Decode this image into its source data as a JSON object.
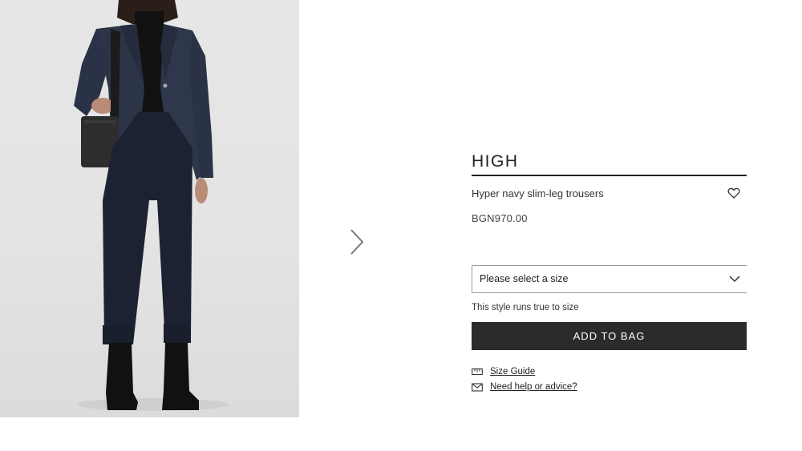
{
  "product": {
    "brand": "HIGH",
    "name": "Hyper navy slim-leg trousers",
    "price": "BGN970.00"
  },
  "size_select": {
    "placeholder": "Please select a size"
  },
  "fit_note": "This style runs true to size",
  "actions": {
    "add_to_bag": "ADD TO BAG"
  },
  "links": {
    "size_guide": "Size Guide",
    "help": "Need help or advice?"
  },
  "icons": {
    "next": "chevron-right-icon",
    "wishlist": "heart-icon",
    "dropdown": "chevron-down-icon",
    "size_guide": "ruler-icon",
    "help": "envelope-icon"
  },
  "colors": {
    "button": "#2b2b2b",
    "image_bg": "#e4e4e4",
    "navy": "#1f2638"
  }
}
